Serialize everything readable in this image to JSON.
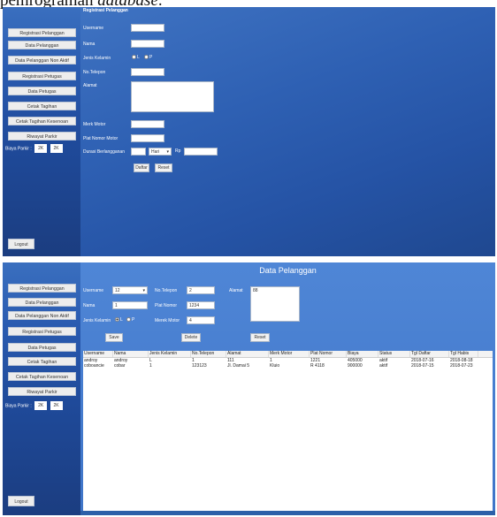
{
  "doc": {
    "prefix": "pemrograman ",
    "italic": "database",
    "suffix": "."
  },
  "sidebar": {
    "items": [
      "Registrasi Pelanggan",
      "Data Pelanggan",
      "Data Pelanggan Non Aktif",
      "Registrasi Petugas",
      "Data Petugas",
      "Cetak Tagihan",
      "Cetak Tagihan Kesenoan",
      "Riwayat Parkir"
    ],
    "tarif_label": "Biaya Parkir :",
    "tarif_a": "2K",
    "tarif_b": "2K",
    "logout": "Logout"
  },
  "form1": {
    "title": "Registrasi Pelanggan",
    "username": "Username",
    "nama": "Nama",
    "jenis_kelamin": "Jenis Kelamin",
    "jk_l": "L",
    "jk_p": "P",
    "no_telepon": "No.Telepon",
    "alamat": "Alamat",
    "merk_motor": "Merk Motor",
    "plat_nomor": "Plat Nomor Motor",
    "durasi": "Durasi Berlangganan",
    "durasi_unit": "Hari",
    "rp": "Rp",
    "daftar": "Daftar",
    "reset": "Reset"
  },
  "form2": {
    "title": "Data Pelanggan",
    "username": "Username",
    "username_val": "12",
    "no_telepon": "No.Telepon",
    "no_telepon_val": "2",
    "alamat": "Alamat",
    "alamat_val": "88",
    "nama": "Nama",
    "nama_val": "1",
    "plat_nomor": "Plat Nomor",
    "plat_nomor_val": "1234",
    "jenis_kelamin": "Jenis Kelamin",
    "jk_l": "L",
    "jk_p": "P",
    "merk_motor": "Merek Motor",
    "merk_motor_val": "4",
    "save": "Save",
    "delete": "Delete",
    "reset": "Reset"
  },
  "table": {
    "headers": [
      "Username",
      "Nama",
      "Jenis Kelamin",
      "No.Telepon",
      "Alamat",
      "Merk Motor",
      "Plat Nomor",
      "Biaya",
      "Status",
      "Tgl Daftar",
      "Tgl Habis"
    ],
    "rows": [
      [
        "androy",
        "androy",
        "L",
        "1",
        "111",
        "1",
        "1221",
        "405000",
        "aktif",
        "2018-07-16",
        "2018-08-18"
      ],
      [
        "coboancie",
        "cobar",
        "1",
        "123123",
        "Jl. Damai 5",
        "Kluio",
        "R 4118",
        "900000",
        "aktif",
        "2018-07-15",
        "2018-07-23"
      ]
    ]
  },
  "colors": {
    "sidebar_top": "#3a6fbf",
    "main_blue": "#2e60b3",
    "panel_blue": "#4f86d6"
  }
}
